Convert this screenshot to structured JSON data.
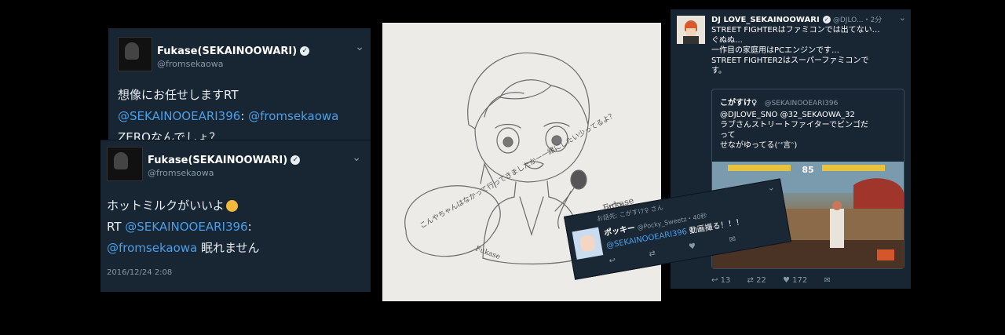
{
  "tweet_a": {
    "name": "Fukase(SEKAINOOWARI)",
    "handle": "@fromsekaowa",
    "line1": "想像にお任せしますRT",
    "mention1": "@SEKAINOOEARI396",
    "sep": ": ",
    "mention2": "@fromsekaowa",
    "line3": "ZEROなんでしょ？"
  },
  "tweet_b": {
    "name": "Fukase(SEKAINOOWARI)",
    "handle": "@fromsekaowa",
    "line1": "ホットミルクがいいよ",
    "rt_prefix": "RT ",
    "mention1": "@SEKAINOOEARI396",
    "colon": ":",
    "mention2": "@fromsekaowa",
    "line3_rest": " 眠れません",
    "date": "2016/12/24 2:08"
  },
  "sketch": {
    "bubble_text": "こんやちゃんはなかって行ってきましたかー一緒にしたい少ってるよ？",
    "signature": "Fukase",
    "signature_right": "Fukase"
  },
  "tweet_c": {
    "name": "DJ LOVE_SEKAINOOWARI",
    "handle": "@DJLO...",
    "time": "・2分",
    "body": [
      "STREET FIGHTERはファミコンでは出てない…",
      "ぐぬぬ…",
      "一作目の家庭用はPCエンジンです…",
      "STREET FIGHTER2はスーパーファミコンで",
      "す。"
    ],
    "quote": {
      "name": "こがすけ♀",
      "handle": "@SEKAINOOEARI396",
      "body": [
        "@DJLOVE_SNO @32_SEKAOWA_32",
        "ラブさんストリートファイターでビンゴだ",
        "って",
        "せながゆってる(ᵔ'言ᵔ)"
      ]
    },
    "game_timer": "85",
    "stats": {
      "reply": "13",
      "retweet": "22",
      "like": "172"
    }
  },
  "tweet_d": {
    "rt_line": "お話先: こがすけ♀ さん",
    "name": "ポッキー",
    "handle": "@Pocky_Sweetz・40秒",
    "mention": "@SEKAINOOEARI396",
    "msg_rest": " 動画撮る！！！"
  }
}
